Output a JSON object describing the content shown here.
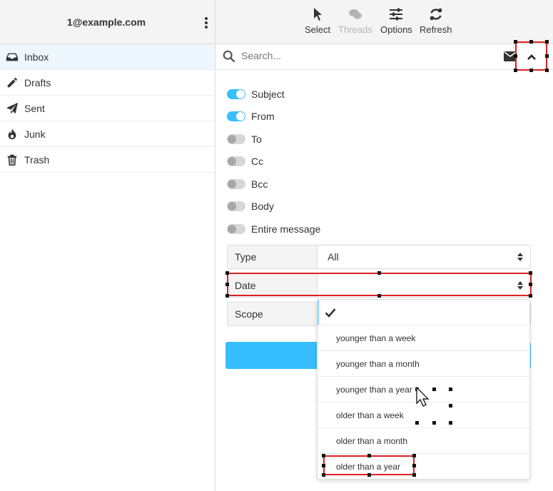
{
  "account": {
    "email": "1@example.com"
  },
  "folders": [
    {
      "label": "Inbox",
      "icon": "inbox-icon"
    },
    {
      "label": "Drafts",
      "icon": "pencil-icon"
    },
    {
      "label": "Sent",
      "icon": "paper-plane-icon"
    },
    {
      "label": "Junk",
      "icon": "fire-icon"
    },
    {
      "label": "Trash",
      "icon": "trash-icon"
    }
  ],
  "toolbar": {
    "select": "Select",
    "threads": "Threads",
    "options": "Options",
    "refresh": "Refresh"
  },
  "search": {
    "placeholder": "Search..."
  },
  "search_options": [
    {
      "label": "Subject",
      "on": true
    },
    {
      "label": "From",
      "on": true
    },
    {
      "label": "To",
      "on": false
    },
    {
      "label": "Cc",
      "on": false
    },
    {
      "label": "Bcc",
      "on": false
    },
    {
      "label": "Body",
      "on": false
    },
    {
      "label": "Entire message",
      "on": false
    }
  ],
  "filters": {
    "type": {
      "label": "Type",
      "value": "All"
    },
    "date": {
      "label": "Date",
      "value": ""
    },
    "scope": {
      "label": "Scope"
    }
  },
  "date_options": [
    "younger than a week",
    "younger than a month",
    "younger than a year",
    "older than a week",
    "older than a month",
    "older than a year"
  ],
  "colors": {
    "accent": "#37beff",
    "highlight": "#e02020"
  }
}
